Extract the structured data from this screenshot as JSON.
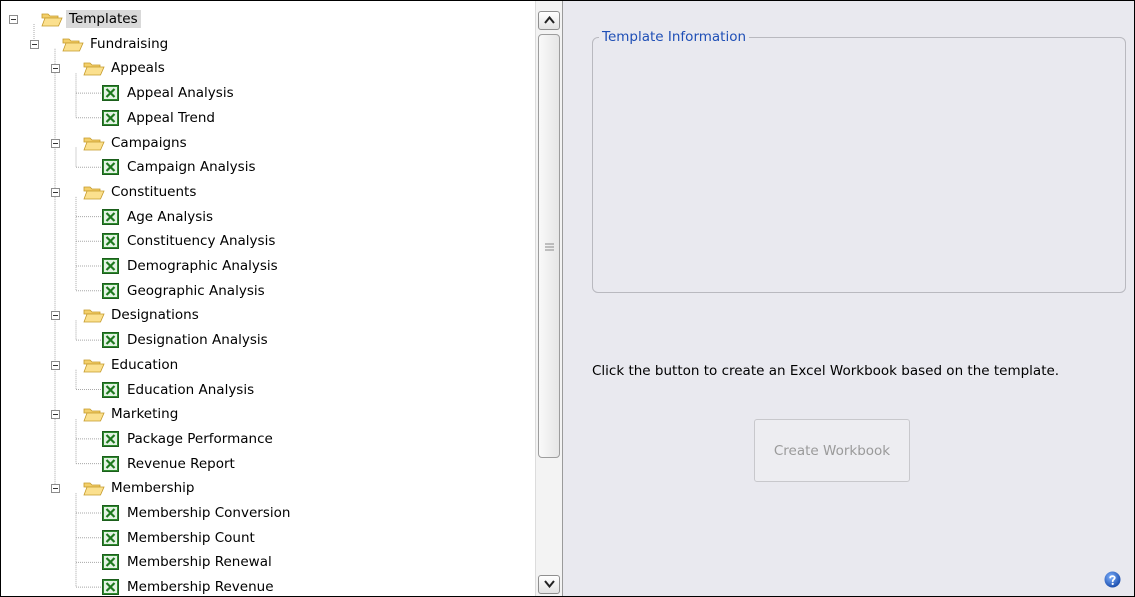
{
  "tree": {
    "root": {
      "label": "Templates",
      "children": [
        {
          "label": "Fundraising",
          "children": [
            {
              "label": "Appeals",
              "children": [
                {
                  "label": "Appeal Analysis"
                },
                {
                  "label": "Appeal Trend"
                }
              ]
            },
            {
              "label": "Campaigns",
              "children": [
                {
                  "label": "Campaign Analysis"
                }
              ]
            },
            {
              "label": "Constituents",
              "children": [
                {
                  "label": "Age Analysis"
                },
                {
                  "label": "Constituency Analysis"
                },
                {
                  "label": "Demographic Analysis"
                },
                {
                  "label": "Geographic Analysis"
                }
              ]
            },
            {
              "label": "Designations",
              "children": [
                {
                  "label": "Designation Analysis"
                }
              ]
            },
            {
              "label": "Education",
              "children": [
                {
                  "label": "Education Analysis"
                }
              ]
            },
            {
              "label": "Marketing",
              "children": [
                {
                  "label": "Package Performance"
                },
                {
                  "label": "Revenue Report"
                }
              ]
            },
            {
              "label": "Membership",
              "children": [
                {
                  "label": "Membership Conversion"
                },
                {
                  "label": "Membership Count"
                },
                {
                  "label": "Membership Renewal"
                },
                {
                  "label": "Membership Revenue"
                }
              ]
            }
          ]
        }
      ]
    }
  },
  "info": {
    "group_title": "Template Information",
    "instruction": "Click the button to create an Excel Workbook based on the template.",
    "create_button": "Create Workbook"
  },
  "colors": {
    "panel_bg": "#e9e9ef",
    "legend_text": "#1f4fb6",
    "selected_bg": "#d9d9d9",
    "excel_green": "#2e8b2e"
  },
  "icons": {
    "folder": "open-folder-icon",
    "template": "excel-workbook-icon",
    "help": "help-icon"
  }
}
